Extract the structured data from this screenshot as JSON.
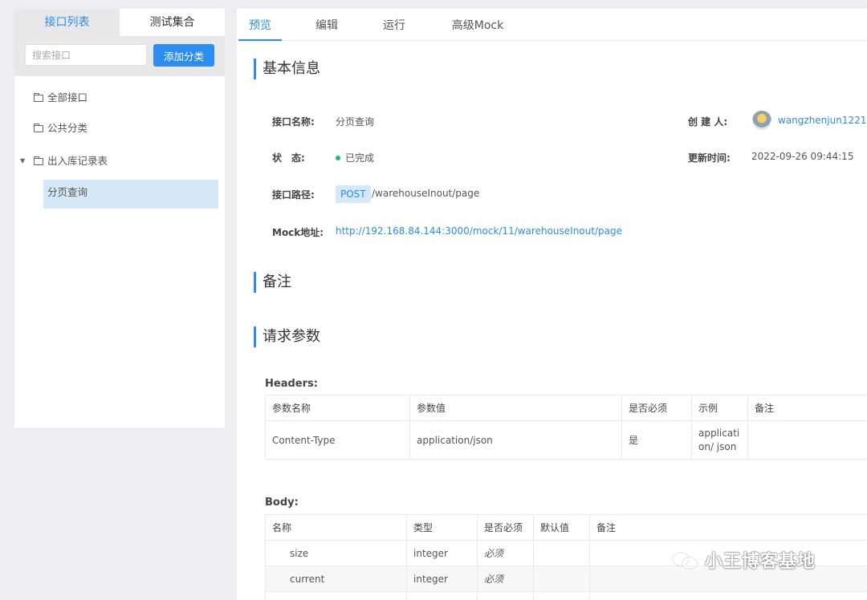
{
  "sidebar": {
    "tabs": [
      {
        "label": "接口列表"
      },
      {
        "label": "测试集合"
      }
    ],
    "search_placeholder": "搜索接口",
    "add_category_label": "添加分类",
    "tree": {
      "all": "全部接口",
      "public": "公共分类",
      "group": "出入库记录表",
      "leaf": "分页查询"
    }
  },
  "tabs": [
    {
      "label": "预览"
    },
    {
      "label": "编辑"
    },
    {
      "label": "运行"
    },
    {
      "label": "高级Mock"
    }
  ],
  "basic": {
    "title": "基本信息",
    "name_label": "接口名称:",
    "name_value": "分页查询",
    "creator_label": "创 建 人:",
    "creator_value": "wangzhenjun1221",
    "status_label": "状　态:",
    "status_value": "已完成",
    "updated_label": "更新时间:",
    "updated_value": "2022-09-26 09:44:15",
    "path_label": "接口路径:",
    "method": "POST",
    "path_value": "/warehouseInout/page",
    "mock_label": "Mock地址:",
    "mock_value": "http://192.168.84.144:3000/mock/11/warehouseInout/page"
  },
  "remark": {
    "title": "备注"
  },
  "params": {
    "title": "请求参数",
    "headers_label": "Headers:",
    "headers_columns": [
      "参数名称",
      "参数值",
      "是否必须",
      "示例",
      "备注"
    ],
    "headers_rows": [
      {
        "name": "Content-Type",
        "value": "application/json",
        "required": "是",
        "example": "application/ json",
        "remark": ""
      }
    ],
    "body_label": "Body:",
    "body_columns": [
      "名称",
      "类型",
      "是否必须",
      "默认值",
      "备注"
    ],
    "body_rows": [
      {
        "name": "size",
        "type": "integer",
        "required": "必须",
        "default": "",
        "remark": ""
      },
      {
        "name": "current",
        "type": "integer",
        "required": "必须",
        "default": "",
        "remark": ""
      }
    ]
  },
  "watermark": "小王博客基地",
  "colors": {
    "accent": "#2d8cf0",
    "success": "#19be6b"
  }
}
